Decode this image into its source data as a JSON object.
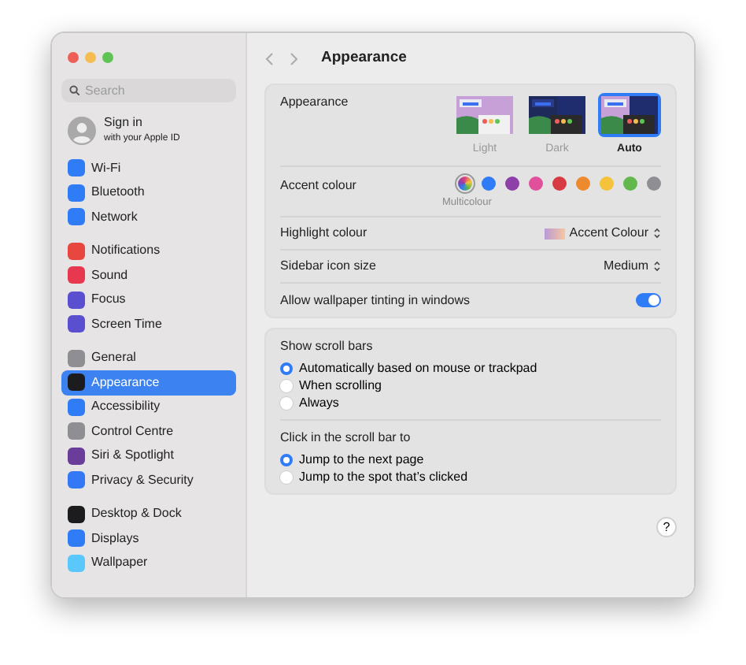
{
  "sidebar": {
    "search": {
      "placeholder": "Search"
    },
    "account": {
      "title": "Sign in",
      "subtitle": "with your Apple ID"
    },
    "groups": [
      [
        {
          "label": "Wi-Fi",
          "color": "#2f7cf6",
          "selected": false
        },
        {
          "label": "Bluetooth",
          "color": "#2f7cf6",
          "selected": false
        },
        {
          "label": "Network",
          "color": "#2f7cf6",
          "selected": false
        }
      ],
      [
        {
          "label": "Notifications",
          "color": "#e8473f",
          "selected": false
        },
        {
          "label": "Sound",
          "color": "#e8384f",
          "selected": false
        },
        {
          "label": "Focus",
          "color": "#5a4fcf",
          "selected": false
        },
        {
          "label": "Screen Time",
          "color": "#5a4fcf",
          "selected": false
        }
      ],
      [
        {
          "label": "General",
          "color": "#8e8e93",
          "selected": false
        },
        {
          "label": "Appearance",
          "color": "#1c1c1e",
          "selected": true
        },
        {
          "label": "Accessibility",
          "color": "#2f7cf6",
          "selected": false
        },
        {
          "label": "Control Centre",
          "color": "#8e8e93",
          "selected": false
        },
        {
          "label": "Siri & Spotlight",
          "color": "#6a3d9a",
          "selected": false
        },
        {
          "label": "Privacy & Security",
          "color": "#3478f6",
          "selected": false
        }
      ],
      [
        {
          "label": "Desktop & Dock",
          "color": "#1c1c1e",
          "selected": false
        },
        {
          "label": "Displays",
          "color": "#2f7cf6",
          "selected": false
        },
        {
          "label": "Wallpaper",
          "color": "#5ac8fa",
          "selected": false
        }
      ]
    ]
  },
  "header": {
    "title": "Appearance"
  },
  "appearance": {
    "label": "Appearance",
    "modes": [
      {
        "kind": "light",
        "label": "Light",
        "selected": false
      },
      {
        "kind": "dark",
        "label": "Dark",
        "selected": false
      },
      {
        "kind": "auto",
        "label": "Auto",
        "selected": true
      }
    ]
  },
  "accent": {
    "label": "Accent colour",
    "selected_name": "Multicolour",
    "colors": [
      {
        "kind": "multi",
        "selected": true
      },
      {
        "kind": "solid",
        "color": "#2f7cf6",
        "selected": false
      },
      {
        "kind": "solid",
        "color": "#8e3fa8",
        "selected": false
      },
      {
        "kind": "solid",
        "color": "#e0509b",
        "selected": false
      },
      {
        "kind": "solid",
        "color": "#d63b43",
        "selected": false
      },
      {
        "kind": "solid",
        "color": "#ee8a2e",
        "selected": false
      },
      {
        "kind": "solid",
        "color": "#f5c33b",
        "selected": false
      },
      {
        "kind": "solid",
        "color": "#62b84c",
        "selected": false
      },
      {
        "kind": "solid",
        "color": "#8e8e93",
        "selected": false
      }
    ]
  },
  "settings": [
    {
      "kind": "colour_popup",
      "label": "Highlight colour",
      "value": "Accent Colour"
    },
    {
      "kind": "popup",
      "label": "Sidebar icon size",
      "value": "Medium"
    },
    {
      "kind": "toggle",
      "label": "Allow wallpaper tinting in windows",
      "on": true
    }
  ],
  "radio_groups": [
    {
      "label": "Show scroll bars",
      "options": [
        {
          "label": "Automatically based on mouse or trackpad",
          "selected": true
        },
        {
          "label": "When scrolling",
          "selected": false
        },
        {
          "label": "Always",
          "selected": false
        }
      ]
    },
    {
      "label": "Click in the scroll bar to",
      "options": [
        {
          "label": "Jump to the next page",
          "selected": true
        },
        {
          "label": "Jump to the spot that’s clicked",
          "selected": false
        }
      ]
    }
  ],
  "help": "?"
}
